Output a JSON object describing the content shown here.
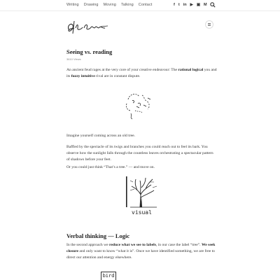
{
  "nav": {
    "items": [
      "Writing",
      "Drawing",
      "Moving",
      "Talking",
      "Contact"
    ]
  },
  "social_icons": [
    "facebook-icon",
    "twitter-icon",
    "linkedin-icon",
    "youtube-icon",
    "instagram-icon",
    "medium-icon"
  ],
  "post": {
    "title": "Seeing vs. reading",
    "views": "3610 Views",
    "intro_a": "An ancient feud rages at the very core of your creative endeavour: The ",
    "intro_bold1": "rational logical",
    "intro_b": " you and its ",
    "intro_bold2": "fuzzy intuitive",
    "intro_c": " rival are in constant dispute.",
    "imagine": "Imagine yourself coming across an old tree.",
    "baffled": "Baffled by the spectacle of its twigs and branches you could reach out to feel its bark. You observe how the sunlight falls through the countless leaves orchestrating a spectacular pattern of shadows before your feet.",
    "or_think": "Or you could just think “That’s a tree.” — and move on.",
    "sketch_visual_label": "visual",
    "section_title": "Verbal thinking — Logic",
    "verbal_a": "In the second approach we ",
    "verbal_bold1": "reduce what we see to labels",
    "verbal_b": ", in our case the label “tree”. ",
    "verbal_bold2": "We seek closure",
    "verbal_c": " and only want to know “what it is”. Once we have identified something, we are free to direct our attention and energy elsewhere.",
    "sketch_bird_label": "bird"
  }
}
